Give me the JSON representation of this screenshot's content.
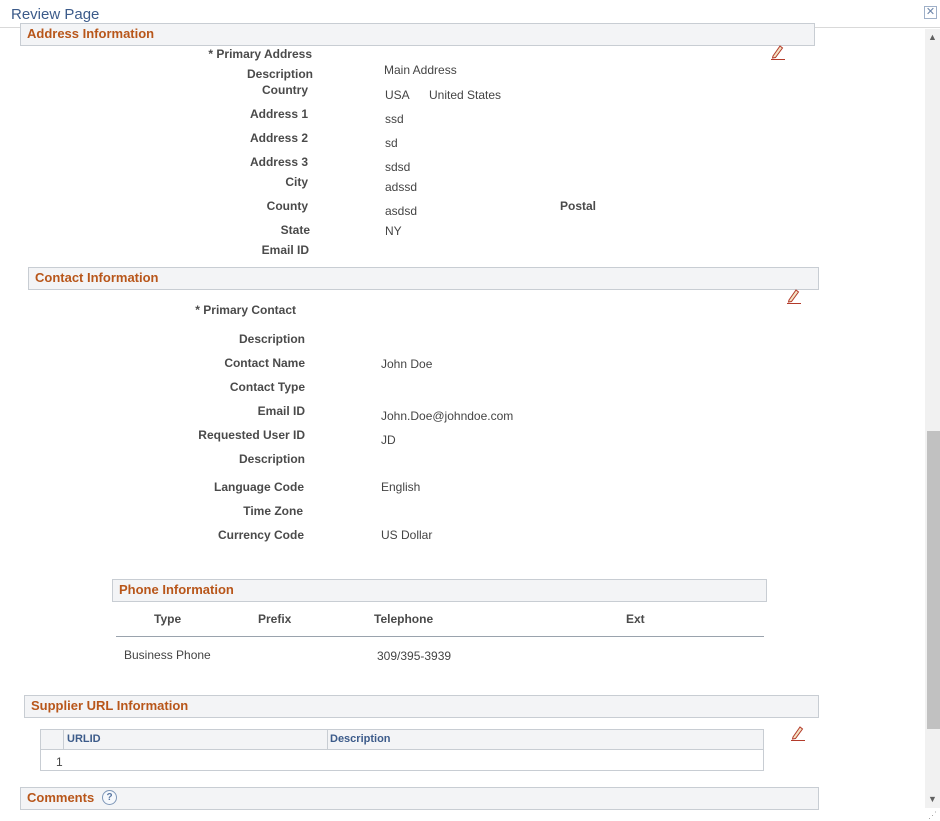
{
  "window": {
    "title": "Review Page",
    "close_label": "✕"
  },
  "address": {
    "header": "Address Information",
    "primary_label": "* Primary Address",
    "description_label": "Description",
    "description_value": "Main Address",
    "country_label": "Country",
    "country_code": "USA",
    "country_name": "United States",
    "address1_label": "Address 1",
    "address1_value": "ssd",
    "address2_label": "Address 2",
    "address2_value": "sd",
    "address3_label": "Address 3",
    "address3_value": "sdsd",
    "city_label": "City",
    "city_value": "adssd",
    "county_label": "County",
    "county_value": "asdsd",
    "postal_label": "Postal",
    "state_label": "State",
    "state_value": "NY",
    "email_label": "Email ID"
  },
  "contact": {
    "header": "Contact Information",
    "primary_label": "* Primary Contact",
    "description_label": "Description",
    "contact_name_label": "Contact Name",
    "contact_name_value": "John Doe",
    "contact_type_label": "Contact Type",
    "email_label": "Email ID",
    "email_value": "John.Doe@johndoe.com",
    "requested_user_label": "Requested User ID",
    "requested_user_value": "JD",
    "description2_label": "Description",
    "language_label": "Language Code",
    "language_value": "English",
    "timezone_label": "Time Zone",
    "currency_label": "Currency Code",
    "currency_value": "US Dollar"
  },
  "phone": {
    "header": "Phone Information",
    "columns": [
      "Type",
      "Prefix",
      "Telephone",
      "Ext"
    ],
    "rows": [
      {
        "type": "Business Phone",
        "prefix": "",
        "telephone": "309/395-3939",
        "ext": ""
      }
    ]
  },
  "url": {
    "header": "Supplier URL Information",
    "columns": [
      "URLID",
      "Description"
    ],
    "rows": [
      {
        "row_num": "1",
        "urlid": "",
        "description": ""
      }
    ]
  },
  "comments": {
    "header": "Comments",
    "help_label": "?"
  },
  "icons": {
    "edit": "pencil-icon",
    "help": "help-icon",
    "close": "close-icon"
  },
  "colors": {
    "section_text": "#b8561a",
    "title_text": "#3c5b8a",
    "section_bg": "#f3f4f6"
  }
}
